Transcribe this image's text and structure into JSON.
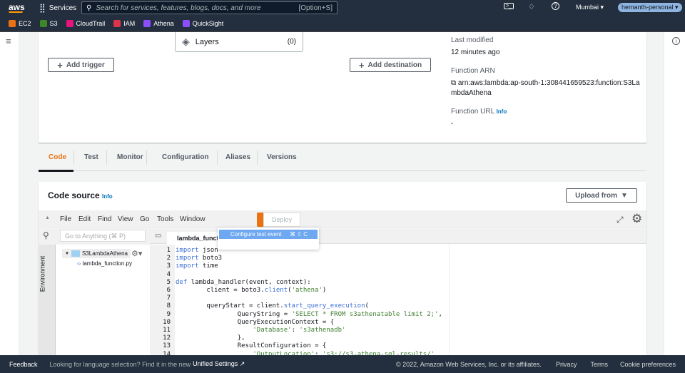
{
  "topnav": {
    "logo": "aws",
    "services": "Services",
    "search_placeholder": "Search for services, features, blogs, docs, and more",
    "search_shortcut": "[Option+S]",
    "region": "Mumbai",
    "account": "hemanth-personal"
  },
  "favorites": [
    {
      "label": "EC2",
      "color": "#ec7211"
    },
    {
      "label": "S3",
      "color": "#3f8624"
    },
    {
      "label": "CloudTrail",
      "color": "#e7157b"
    },
    {
      "label": "IAM",
      "color": "#dd344c"
    },
    {
      "label": "Athena",
      "color": "#8c4fff"
    },
    {
      "label": "QuickSight",
      "color": "#8c4fff"
    }
  ],
  "overview": {
    "layers_label": "Layers",
    "layers_count": "(0)",
    "add_trigger": "Add trigger",
    "add_destination": "Add destination",
    "last_modified_label": "Last modified",
    "last_modified_value": "12 minutes ago",
    "arn_label": "Function ARN",
    "arn_line1": "arn:aws:lambda:ap-south-1:308441659523:function:S3La",
    "arn_line2": "mbdaAthena",
    "url_label": "Function URL",
    "url_info": "Info",
    "url_value": "-"
  },
  "tabs": [
    {
      "label": "Code",
      "active": true
    },
    {
      "label": "Test"
    },
    {
      "label": "Monitor"
    },
    {
      "label": "Configuration"
    },
    {
      "label": "Aliases"
    },
    {
      "label": "Versions"
    }
  ],
  "code_source": {
    "title": "Code source",
    "info": "Info",
    "upload_from": "Upload from"
  },
  "ide": {
    "menu": [
      "File",
      "Edit",
      "Find",
      "View",
      "Go",
      "Tools",
      "Window"
    ],
    "test": "Test",
    "deploy": "Deploy",
    "dropdown_item": "Configure test event",
    "dropdown_shortcut": "⌘ ⇧ C",
    "goto_placeholder": "Go to Anything (⌘ P)",
    "environment": "Environment",
    "folder": "S3LambdaAthena",
    "file": "lambda_function.py",
    "editor_tab": "lambda_functio",
    "lines": [
      "1",
      "2",
      "3",
      "4",
      "5",
      "6",
      "7",
      "8",
      "9",
      "10",
      "11",
      "12",
      "13",
      "14"
    ]
  },
  "footer": {
    "feedback": "Feedback",
    "lang_text": "Looking for language selection? Find it in the new",
    "unified": "Unified Settings",
    "copyright": "© 2022, Amazon Web Services, Inc. or its affiliates.",
    "privacy": "Privacy",
    "terms": "Terms",
    "cookies": "Cookie preferences"
  },
  "colors": {
    "nav": "#232f3e",
    "accent": "#ec7211",
    "link": "#0073bb"
  }
}
